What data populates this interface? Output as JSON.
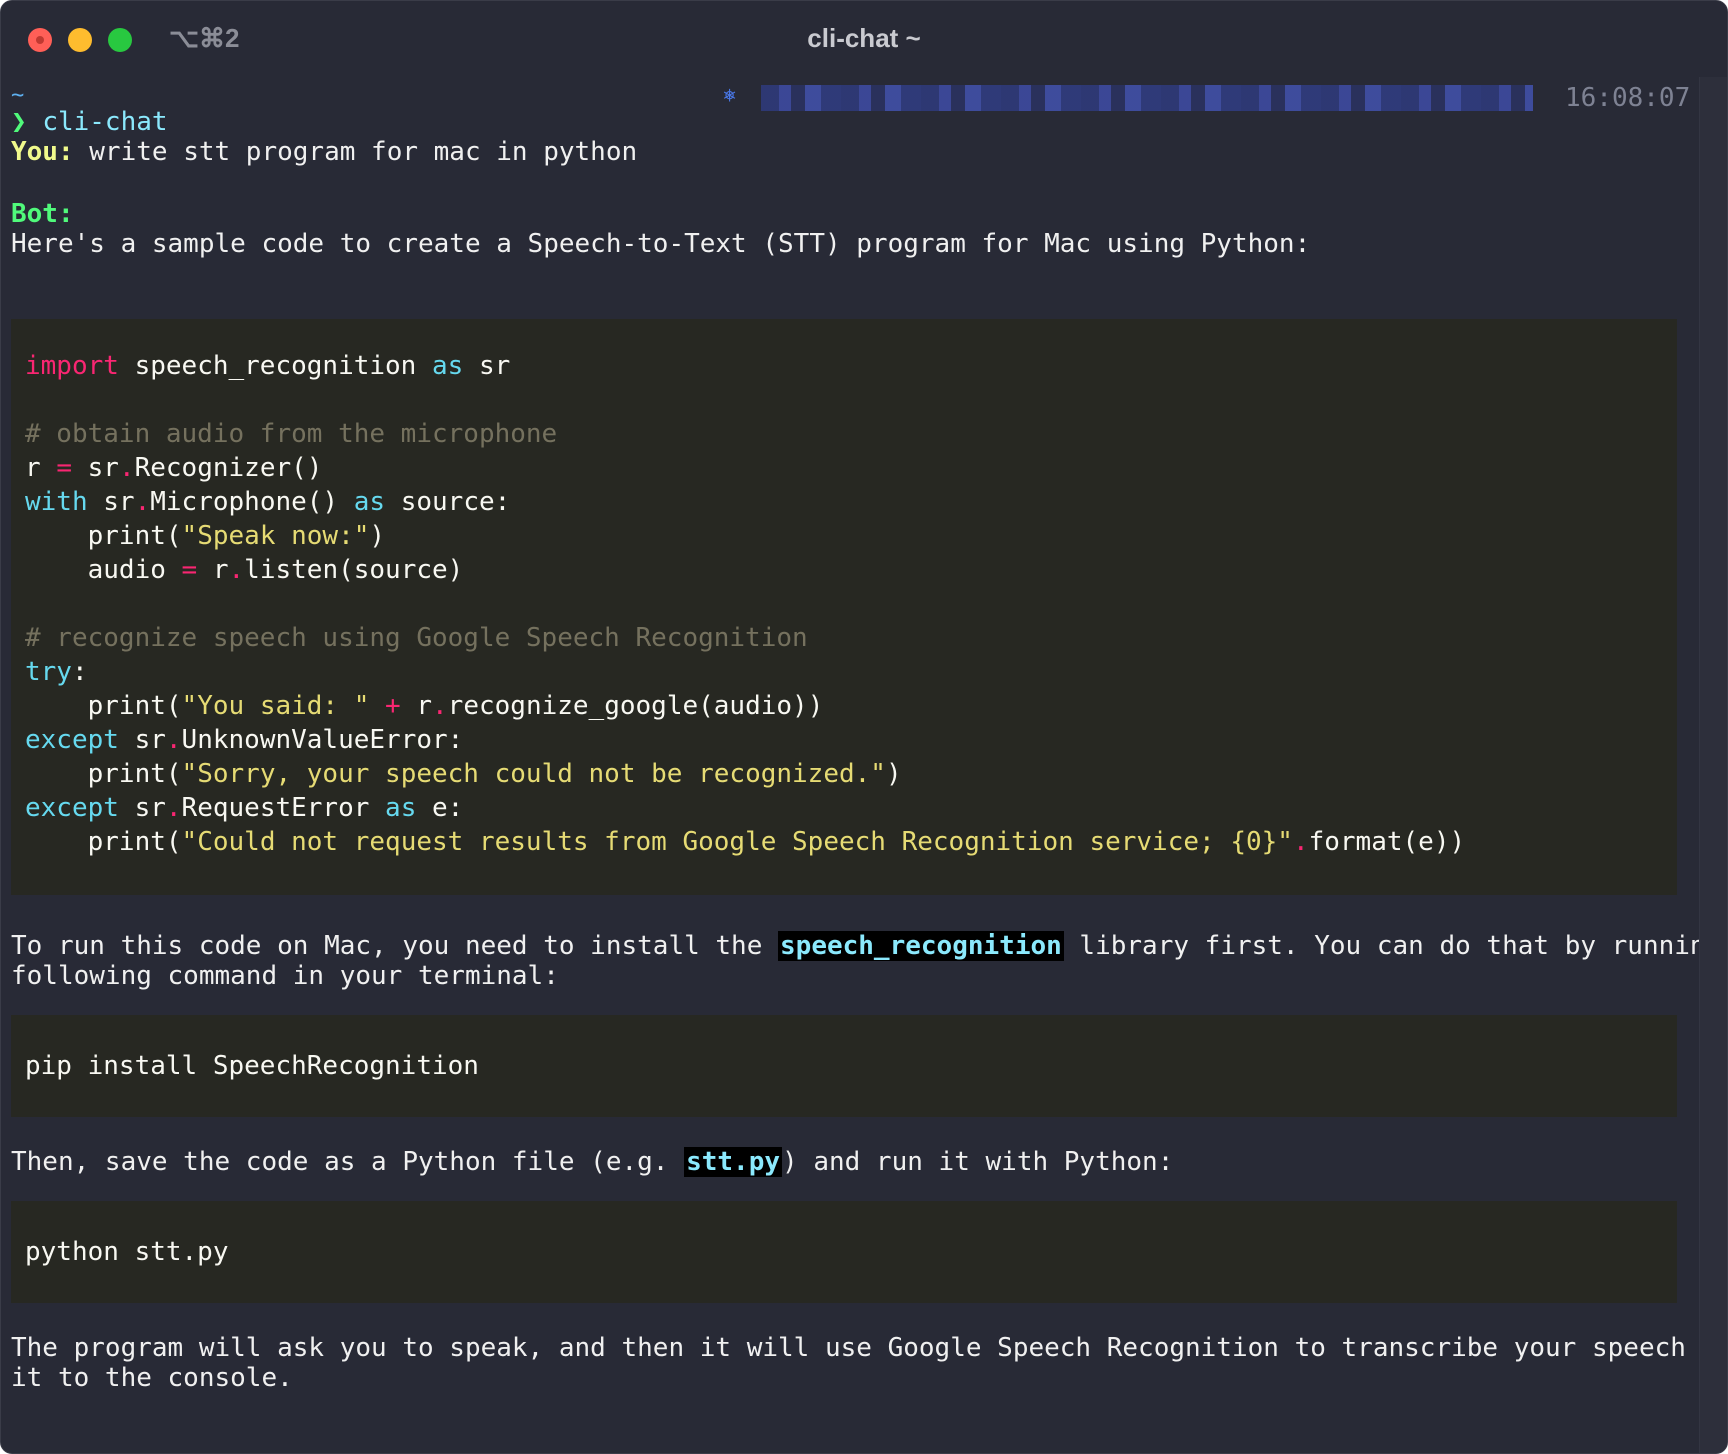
{
  "window": {
    "shortcut": "⌥⌘2",
    "title": "cli-chat ~"
  },
  "status": {
    "cwd": "~",
    "time": "16:08:07",
    "gear_icon": "kubernetes-icon"
  },
  "prompt": {
    "arrow": "❯",
    "command": "cli-chat"
  },
  "chat": {
    "user_label": "You:",
    "user_message": " write stt program for mac in python",
    "bot_label": "Bot:",
    "intro": "Here's a sample code to create a Speech-to-Text (STT) program for Mac using Python:",
    "code_main": [
      [
        {
          "t": "import",
          "c": "kw"
        },
        {
          "t": " speech_recognition "
        },
        {
          "t": "as",
          "c": "kb"
        },
        {
          "t": " sr"
        }
      ],
      [],
      [
        {
          "t": "# obtain audio from the microphone",
          "c": "cm"
        }
      ],
      [
        {
          "t": "r "
        },
        {
          "t": "=",
          "c": "kw"
        },
        {
          "t": " sr"
        },
        {
          "t": ".",
          "c": "kw"
        },
        {
          "t": "Recognizer()"
        }
      ],
      [
        {
          "t": "with",
          "c": "kb"
        },
        {
          "t": " sr"
        },
        {
          "t": ".",
          "c": "kw"
        },
        {
          "t": "Microphone() "
        },
        {
          "t": "as",
          "c": "kb"
        },
        {
          "t": " source:"
        }
      ],
      [
        {
          "t": "    print("
        },
        {
          "t": "\"Speak now:\"",
          "c": "st"
        },
        {
          "t": ")"
        }
      ],
      [
        {
          "t": "    audio "
        },
        {
          "t": "=",
          "c": "kw"
        },
        {
          "t": " r"
        },
        {
          "t": ".",
          "c": "kw"
        },
        {
          "t": "listen(source)"
        }
      ],
      [],
      [
        {
          "t": "# recognize speech using Google Speech Recognition",
          "c": "cm"
        }
      ],
      [
        {
          "t": "try",
          "c": "kb"
        },
        {
          "t": ":"
        }
      ],
      [
        {
          "t": "    print("
        },
        {
          "t": "\"You said: \"",
          "c": "st"
        },
        {
          "t": " "
        },
        {
          "t": "+",
          "c": "kw"
        },
        {
          "t": " r"
        },
        {
          "t": ".",
          "c": "kw"
        },
        {
          "t": "recognize_google(audio))"
        }
      ],
      [
        {
          "t": "except",
          "c": "kb"
        },
        {
          "t": " sr"
        },
        {
          "t": ".",
          "c": "kw"
        },
        {
          "t": "UnknownValueError:"
        }
      ],
      [
        {
          "t": "    print("
        },
        {
          "t": "\"Sorry, your speech could not be recognized.\"",
          "c": "st"
        },
        {
          "t": ")"
        }
      ],
      [
        {
          "t": "except",
          "c": "kb"
        },
        {
          "t": " sr"
        },
        {
          "t": ".",
          "c": "kw"
        },
        {
          "t": "RequestError "
        },
        {
          "t": "as",
          "c": "kb"
        },
        {
          "t": " e:"
        }
      ],
      [
        {
          "t": "    print("
        },
        {
          "t": "\"Could not request results from Google Speech Recognition service; {0}\"",
          "c": "st"
        },
        {
          "t": ".",
          "c": "kw"
        },
        {
          "t": "format(e))"
        }
      ]
    ],
    "install_text_1a": "To run this code on Mac, you need to install the ",
    "install_code": "speech_recognition",
    "install_text_1b": " library first. You can do that by running the",
    "install_text_2": "following command in your terminal:",
    "pip_command": "pip install SpeechRecognition",
    "save_text_a": "Then, save the code as a Python file (e.g. ",
    "save_code": "stt.py",
    "save_text_b": ") and run it with Python:",
    "run_command": "python stt.py",
    "outro_1": "The program will ask you to speak, and then it will use Google Speech Recognition to transcribe your speech and print",
    "outro_2": "it to the console."
  }
}
